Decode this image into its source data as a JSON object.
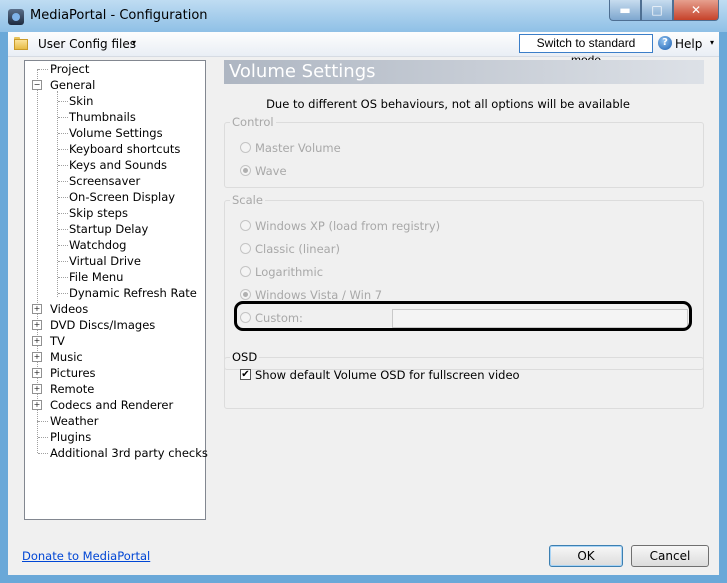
{
  "window": {
    "title": "MediaPortal - Configuration",
    "buttons": {
      "minimize": "▬",
      "maximize": "□",
      "close": "✕"
    }
  },
  "toolbar": {
    "user_config": "User Config files",
    "switch_mode": "Switch to standard mode",
    "help": "Help",
    "help_icon_glyph": "?",
    "dropdown_glyph": "▾"
  },
  "tree": {
    "items": [
      {
        "label": "Project"
      },
      {
        "label": "General",
        "expanded": true
      },
      {
        "label": "Skin"
      },
      {
        "label": "Thumbnails"
      },
      {
        "label": "Volume Settings",
        "selected": true
      },
      {
        "label": "Keyboard shortcuts"
      },
      {
        "label": "Keys and Sounds"
      },
      {
        "label": "Screensaver"
      },
      {
        "label": "On-Screen Display"
      },
      {
        "label": "Skip steps"
      },
      {
        "label": "Startup Delay"
      },
      {
        "label": "Watchdog"
      },
      {
        "label": "Virtual Drive"
      },
      {
        "label": "File Menu"
      },
      {
        "label": "Dynamic Refresh Rate"
      },
      {
        "label": "Videos",
        "expandable": true
      },
      {
        "label": "DVD Discs/Images",
        "expandable": true
      },
      {
        "label": "TV",
        "expandable": true
      },
      {
        "label": "Music",
        "expandable": true
      },
      {
        "label": "Pictures",
        "expandable": true
      },
      {
        "label": "Remote",
        "expandable": true
      },
      {
        "label": "Codecs and Renderer",
        "expandable": true
      },
      {
        "label": "Weather"
      },
      {
        "label": "Plugins"
      },
      {
        "label": "Additional 3rd party checks"
      }
    ],
    "expand_glyph": "+",
    "collapse_glyph": "−"
  },
  "panel": {
    "title": "Volume Settings",
    "notice": "Due to different OS behaviours, not all options will be available",
    "control": {
      "label": "Control",
      "options": [
        {
          "label": "Master Volume",
          "checked": false
        },
        {
          "label": "Wave",
          "checked": true
        }
      ]
    },
    "scale": {
      "label": "Scale",
      "options": [
        {
          "label": "Windows XP (load from registry)",
          "checked": false
        },
        {
          "label": "Classic (linear)",
          "checked": false
        },
        {
          "label": "Logarithmic",
          "checked": false
        },
        {
          "label": "Windows Vista / Win 7",
          "checked": true
        },
        {
          "label": "Custom:",
          "checked": false
        }
      ],
      "custom_value": ""
    },
    "osd": {
      "label": "OSD",
      "checkbox_label": "Show default Volume OSD for fullscreen video",
      "checked": true,
      "check_glyph": "✔"
    }
  },
  "footer": {
    "donate": "Donate to MediaPortal",
    "ok": "OK",
    "cancel": "Cancel"
  },
  "colors": {
    "link": "#0046d5",
    "highlight": "#000000"
  }
}
